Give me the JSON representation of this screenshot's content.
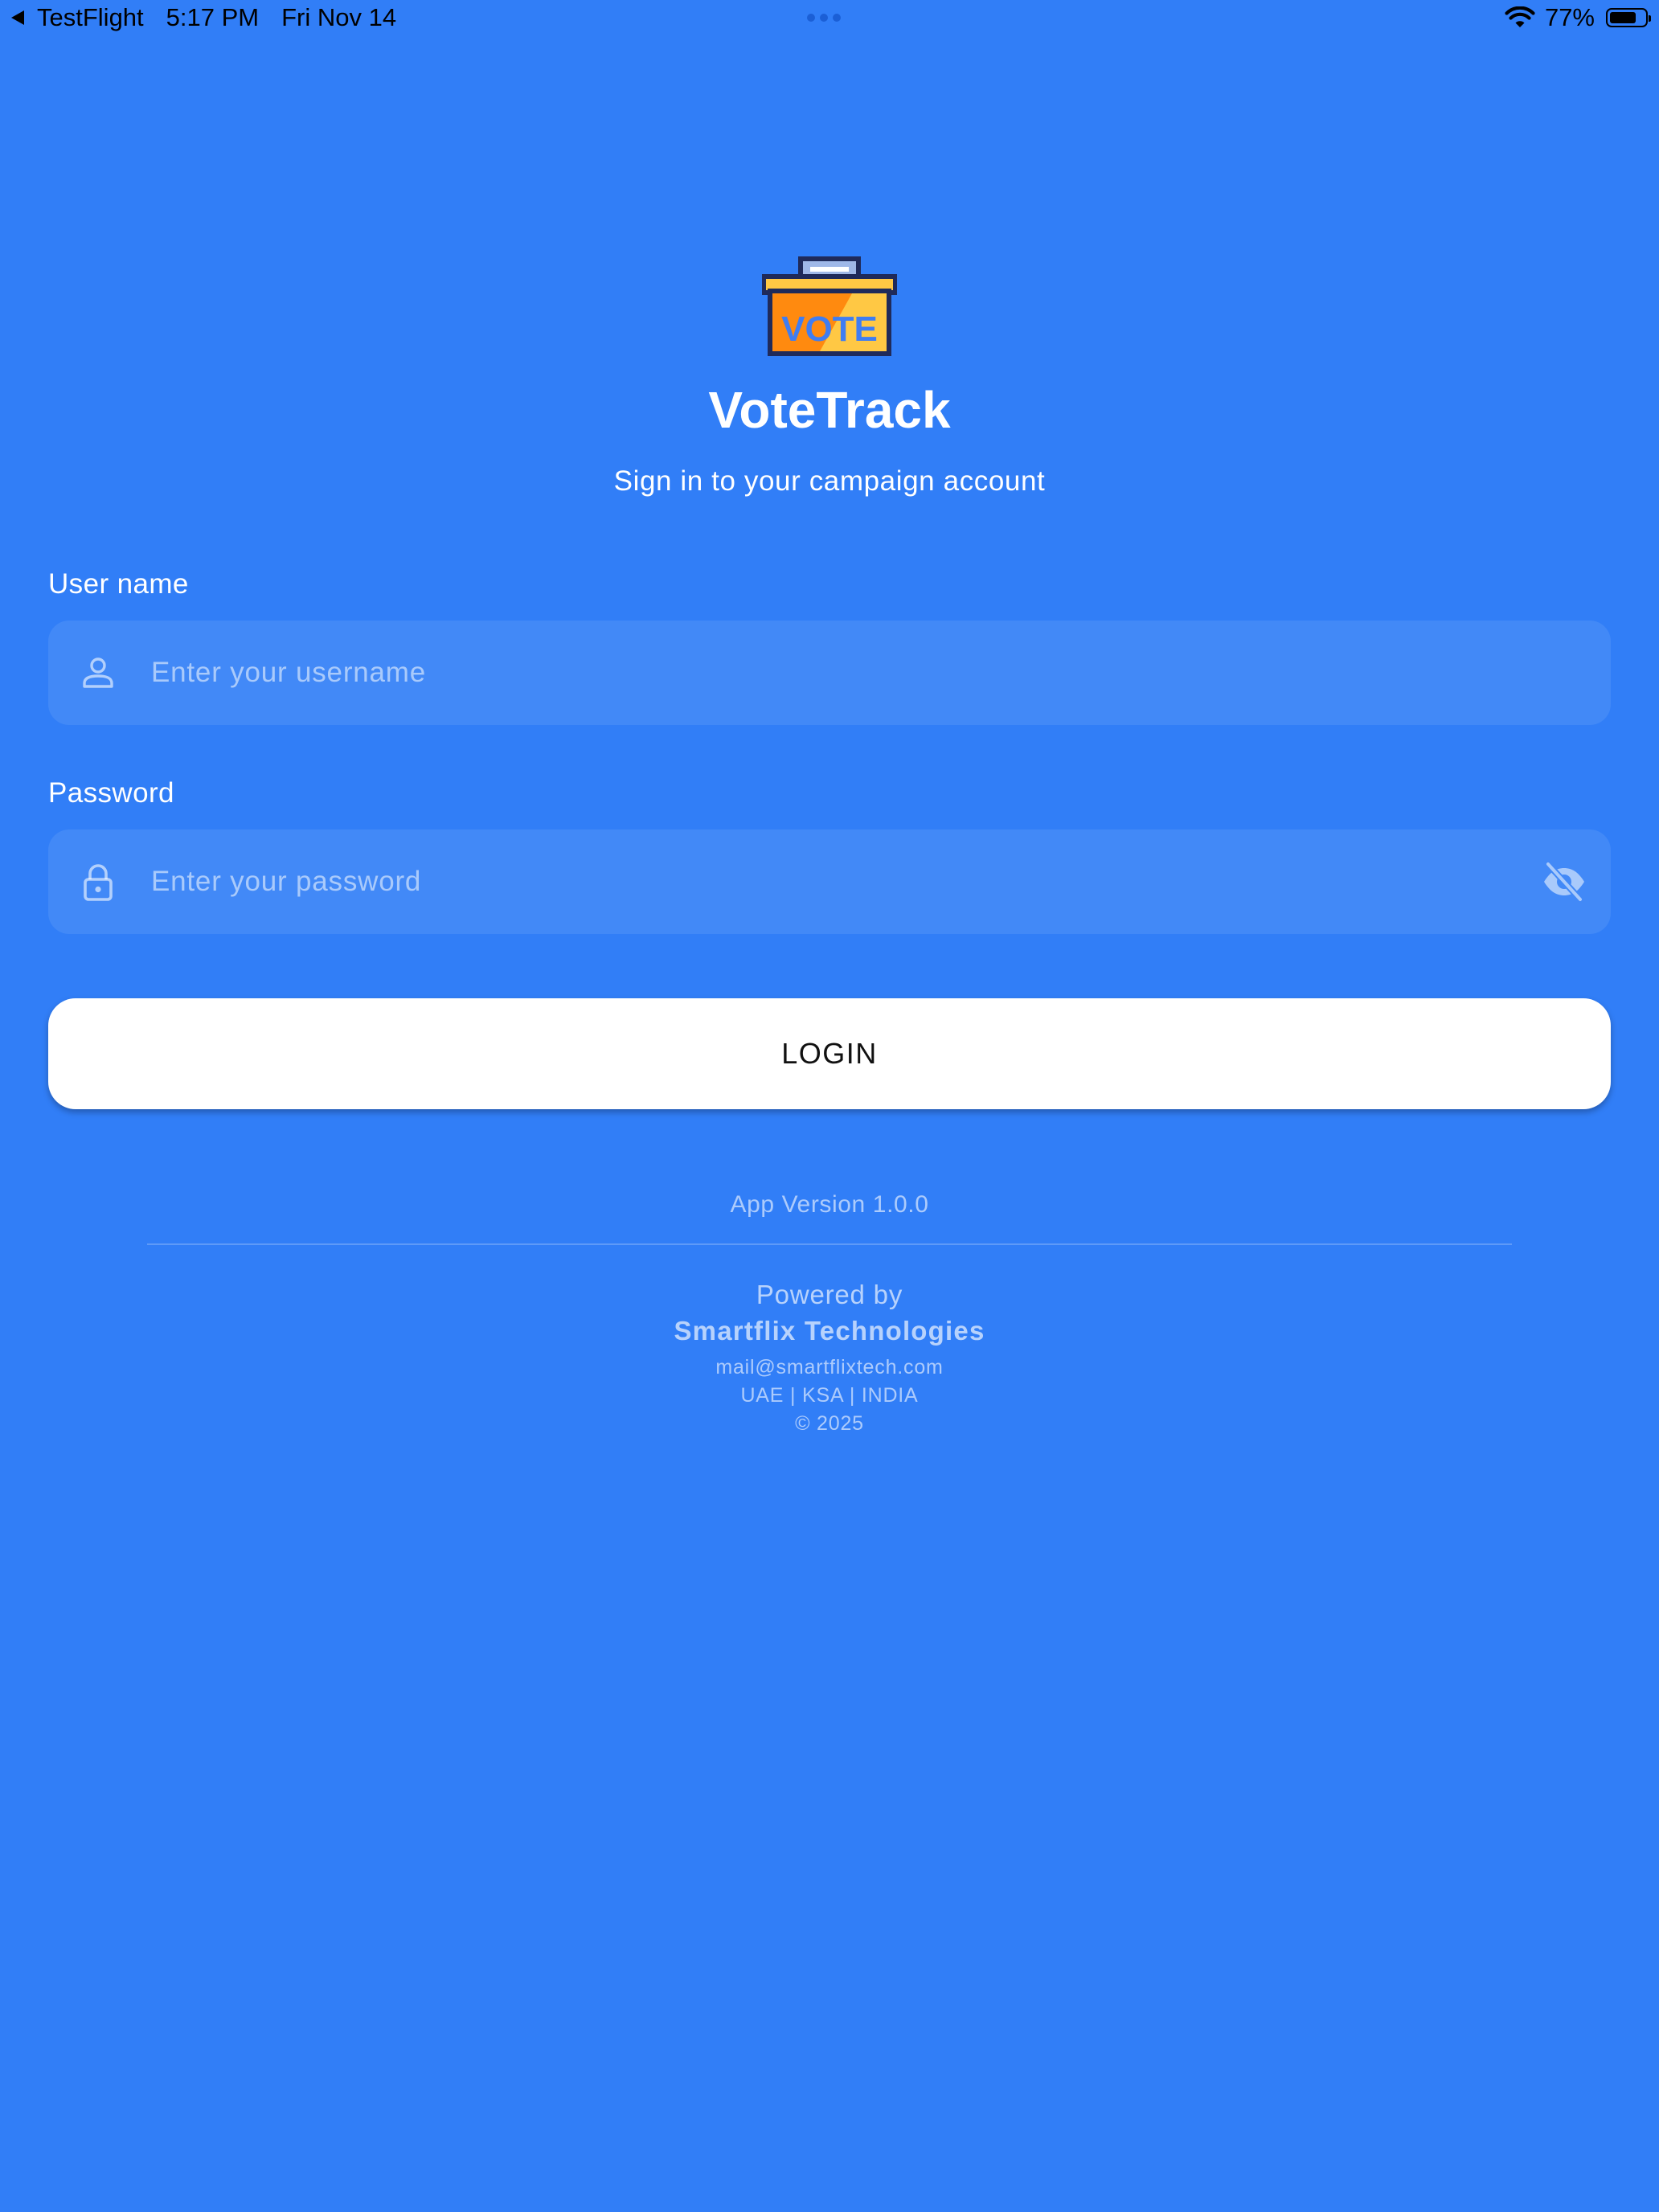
{
  "status_bar": {
    "back_app": "TestFlight",
    "time": "5:17 PM",
    "date": "Fri Nov 14",
    "battery_percent": "77%",
    "battery_level": 0.77
  },
  "app": {
    "title": "VoteTrack",
    "subtitle": "Sign in to your campaign account",
    "logo_text": "VOTE",
    "logo_icon": "ballot-box-icon"
  },
  "form": {
    "username": {
      "label": "User name",
      "placeholder": "Enter your username",
      "value": "",
      "icon": "person-icon"
    },
    "password": {
      "label": "Password",
      "placeholder": "Enter your password",
      "value": "",
      "icon": "lock-icon",
      "toggle_icon": "eye-off-icon"
    },
    "login_label": "LOGIN"
  },
  "footer": {
    "app_version": "App Version 1.0.0",
    "powered_by": "Powered by",
    "company": "Smartflix Technologies",
    "email": "mail@smartflixtech.com",
    "regions": "UAE | KSA | INDIA",
    "copyright": "© 2025"
  },
  "colors": {
    "background": "#317ef7",
    "input_background": "#4289f7",
    "button_background": "#ffffff",
    "button_text": "#111111",
    "logo_orange": "#ff8a0f",
    "logo_yellow": "#ffc844",
    "logo_navy": "#1f2a5a"
  }
}
